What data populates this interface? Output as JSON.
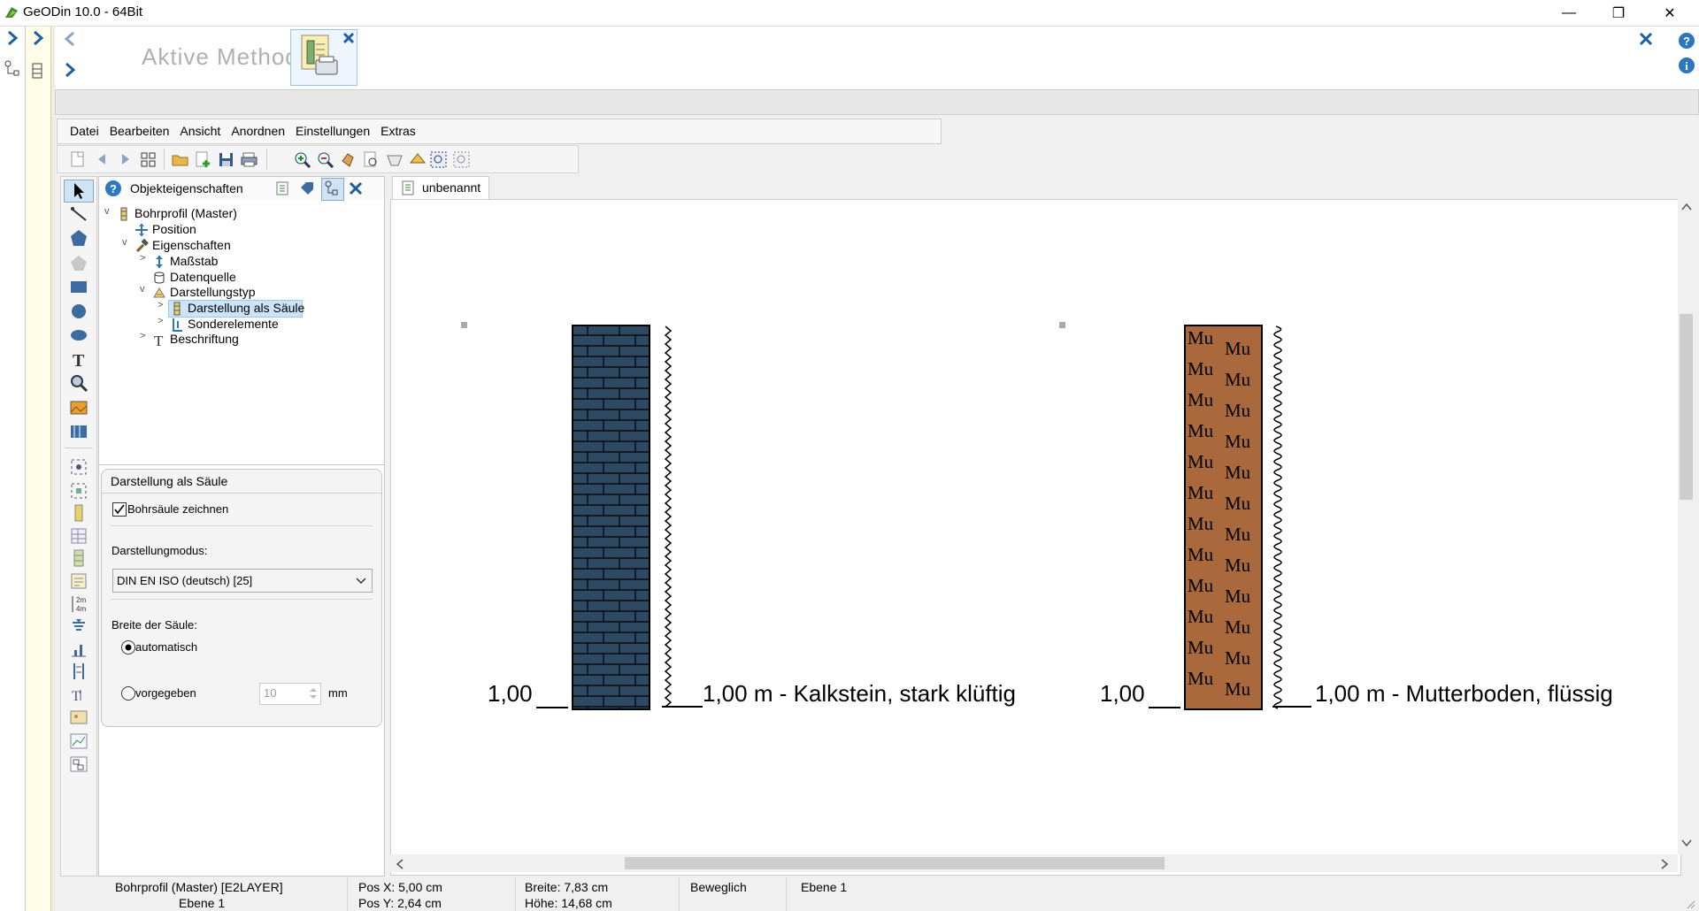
{
  "window": {
    "title": "GeODin 10.0  - 64Bit",
    "minimize": "—",
    "maximize": "❐",
    "close": "✕"
  },
  "methods": {
    "label": "Aktive Methoden:"
  },
  "menu": [
    "Datei",
    "Bearbeiten",
    "Ansicht",
    "Anordnen",
    "Einstellungen",
    "Extras"
  ],
  "properties": {
    "title": "Objekteigenschaften",
    "tree": {
      "root": "Bohrprofil (Master)",
      "position": "Position",
      "eigenschaften": "Eigenschaften",
      "massstab": "Maßstab",
      "datenquelle": "Datenquelle",
      "darstellungstyp": "Darstellungstyp",
      "darstellung_saeule": "Darstellung als Säule",
      "sonderelemente": "Sonderelemente",
      "beschriftung": "Beschriftung"
    },
    "group": {
      "title": "Darstellung als Säule",
      "checkbox_label": "Bohrsäule zeichnen",
      "checkbox_checked": true,
      "mode_label": "Darstellungmodus:",
      "mode_value": "DIN EN ISO (deutsch) [25]",
      "width_label": "Breite der Säule:",
      "radio_auto": "automatisch",
      "radio_given": "vorgegeben",
      "width_value": "10",
      "width_unit": "mm"
    }
  },
  "document": {
    "tab": "unbenannt"
  },
  "canvas": {
    "column1": {
      "depth": "1,00",
      "label": "1,00 m - Kalkstein, stark klüftig",
      "fill": "#2e4a63",
      "pattern": "brick"
    },
    "column2": {
      "depth": "1,00",
      "label": "1,00 m - Mutterboden, flüssig",
      "fill": "#a9693d",
      "pattern": "Mu"
    }
  },
  "status": {
    "object": "Bohrprofil (Master) [E2LAYER]",
    "layer_label": "Ebene 1",
    "pos_x": "Pos X: 5,00 cm",
    "pos_y": "Pos Y: 2,64 cm",
    "width": "Breite: 7,83 cm",
    "height": "Höhe: 14,68 cm",
    "mode": "Beweglich",
    "layer": "Ebene 1"
  }
}
